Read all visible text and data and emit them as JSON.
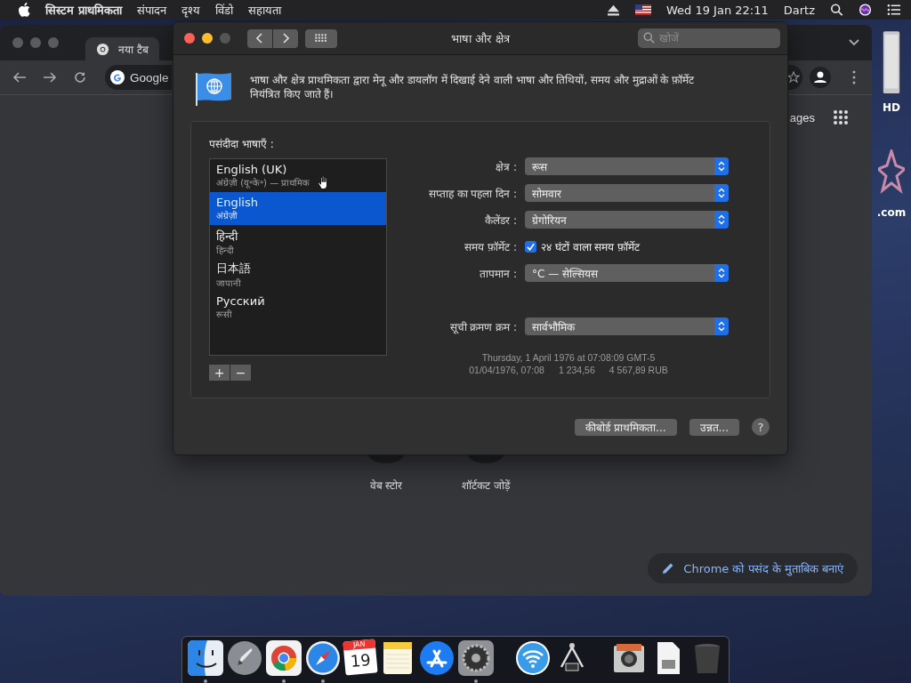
{
  "menu_bar": {
    "app_name": "सिस्टम प्राथमिकता",
    "menus": [
      "संपादन",
      "दृश्य",
      "विंडो",
      "सहायता"
    ],
    "clock": "Wed 19 Jan  22:11",
    "user": "Dartz"
  },
  "desktop_icons": [
    {
      "label": "HD",
      "kind": "drive"
    },
    {
      "label": ".com",
      "kind": "star"
    }
  ],
  "browser": {
    "tab_title": "नया टैब",
    "address": "Google",
    "images_link": "ages",
    "shortcuts": [
      {
        "label": "वेब स्टोर"
      },
      {
        "label": "शॉर्टकट जोड़ें"
      }
    ],
    "customize_button": "Chrome को पसंद के मुताबिक बनाएं"
  },
  "prefs_window": {
    "title": "भाषा और क्षेत्र",
    "search_placeholder": "खोजें",
    "description": "भाषा और क्षेत्र प्राथमिकता द्वारा मेनू और डायलॉग में दिखाई देने वाली भाषा और तिथियों, समय और मुद्राओं के फ़ॉर्मेट नियंत्रित किए जाते हैं।",
    "languages_label": "पसंदीदा भाषाएँ :",
    "languages": [
      {
        "name": "English (UK)",
        "subtitle": "अंग्रेज़ी (यू॰के॰) — प्राथमिक",
        "selected": false
      },
      {
        "name": "English",
        "subtitle": "अंग्रेज़ी",
        "selected": true
      },
      {
        "name": "हिन्दी",
        "subtitle": "हिन्दी",
        "selected": false
      },
      {
        "name": "日本語",
        "subtitle": "जापानी",
        "selected": false
      },
      {
        "name": "Русский",
        "subtitle": "रूसी",
        "selected": false
      }
    ],
    "add_button": "+",
    "remove_button": "−",
    "settings": [
      {
        "kind": "select",
        "label": "क्षेत्र :",
        "value": "रूस"
      },
      {
        "kind": "select",
        "label": "सप्ताह का पहला दिन :",
        "value": "सोमवार"
      },
      {
        "kind": "select",
        "label": "कैलेंडर :",
        "value": "ग्रेगोरियन"
      },
      {
        "kind": "checkbox",
        "label": "समय फ़ॉर्मेट :",
        "value": "२४ घंटों वाला समय फ़ॉर्मेट",
        "checked": true
      },
      {
        "kind": "select",
        "label": "तापमान :",
        "value": "°C — सेल्सियस"
      },
      {
        "kind": "spacer"
      },
      {
        "kind": "select",
        "label": "सूची क्रमण क्रम :",
        "value": "सार्वभौमिक"
      }
    ],
    "sample_date": "Thursday, 1 April 1976 at 07:08:09 GMT-5",
    "sample_values": [
      "01/04/1976, 07:08",
      "1 234,56",
      "4 567,89 RUB"
    ],
    "buttons": [
      "कीबोर्ड प्राथमिकता...",
      "उन्नत..."
    ],
    "help_button": "?"
  },
  "dock": [
    {
      "kind": "finder",
      "running": true
    },
    {
      "kind": "launchpad",
      "running": false
    },
    {
      "kind": "chrome",
      "running": true
    },
    {
      "kind": "safari",
      "running": true
    },
    {
      "kind": "calendar",
      "running": false,
      "month": "JAN",
      "day": "19"
    },
    {
      "kind": "notes",
      "running": false
    },
    {
      "kind": "appstore",
      "running": false
    },
    {
      "kind": "settings",
      "running": true
    },
    {
      "kind": "separator"
    },
    {
      "kind": "wifi",
      "running": false
    },
    {
      "kind": "calipers",
      "running": false
    },
    {
      "kind": "separator"
    },
    {
      "kind": "preview",
      "running": false
    },
    {
      "kind": "document",
      "running": false
    },
    {
      "kind": "trash",
      "running": false
    }
  ]
}
